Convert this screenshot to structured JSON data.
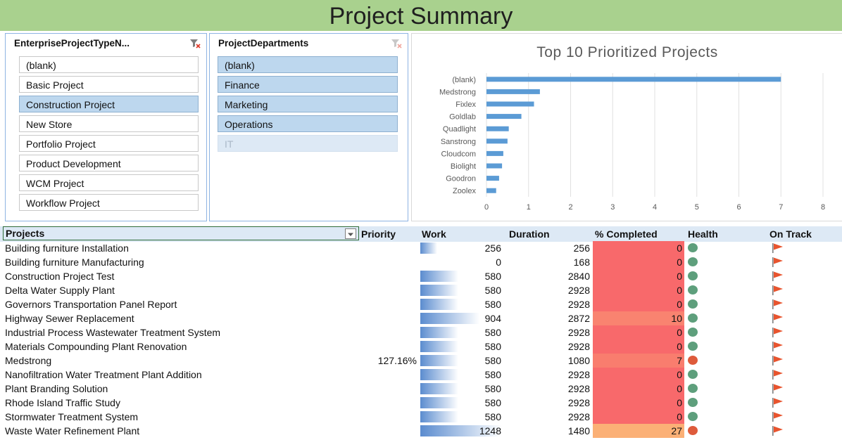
{
  "banner": {
    "title": "Project Summary",
    "color": "#a9d18e"
  },
  "slicers": [
    {
      "header": "EnterpriseProjectTypeN...",
      "icon": "clear-filter-icon",
      "items": [
        {
          "label": "(blank)",
          "state": "normal"
        },
        {
          "label": "Basic Project",
          "state": "normal"
        },
        {
          "label": "Construction Project",
          "state": "selected"
        },
        {
          "label": "New Store",
          "state": "normal"
        },
        {
          "label": "Portfolio Project",
          "state": "normal"
        },
        {
          "label": "Product Development",
          "state": "normal"
        },
        {
          "label": "WCM Project",
          "state": "normal"
        },
        {
          "label": "Workflow Project",
          "state": "normal"
        }
      ]
    },
    {
      "header": "ProjectDepartments",
      "icon": "clear-filter-icon",
      "items": [
        {
          "label": "(blank)",
          "state": "selected"
        },
        {
          "label": "Finance",
          "state": "selected"
        },
        {
          "label": "Marketing",
          "state": "selected"
        },
        {
          "label": "Operations",
          "state": "selected"
        },
        {
          "label": "IT",
          "state": "disabled"
        }
      ]
    }
  ],
  "chart_data": {
    "type": "bar",
    "orientation": "horizontal",
    "title": "Top 10 Prioritized Projects",
    "categories": [
      "(blank)",
      "Medstrong",
      "Fixlex",
      "Goldlab",
      "Quadlight",
      "Sanstrong",
      "Cloudcom",
      "Biolight",
      "Goodron",
      "Zoolex"
    ],
    "values": [
      7,
      1.27,
      1.13,
      0.83,
      0.53,
      0.5,
      0.4,
      0.37,
      0.3,
      0.23
    ],
    "xlim": [
      0,
      8
    ],
    "xticks": [
      "0",
      "1",
      "2",
      "3",
      "4",
      "5",
      "6",
      "7",
      "8"
    ],
    "grid": true,
    "bar_color": "#5b9bd5"
  },
  "table": {
    "headers": {
      "projects": "Projects",
      "priority": "Priority",
      "work": "Work",
      "duration": "Duration",
      "completed": "% Completed",
      "health": "Health",
      "on_track": "On Track"
    },
    "filter_icon": "dropdown-filter-icon",
    "status_colors": {
      "green": "#5e9f7c",
      "red": "#de5b3b",
      "flag": "#e8542e"
    },
    "rows": [
      {
        "name": "Building furniture Installation",
        "priority": "",
        "work": "256",
        "work_fraction": 0.205,
        "duration": "256",
        "completed": "0",
        "completed_color": "#f8696b",
        "health": "green"
      },
      {
        "name": "Building furniture Manufacturing",
        "priority": "",
        "work": "0",
        "work_fraction": 0,
        "duration": "168",
        "completed": "0",
        "completed_color": "#f8696b",
        "health": "green"
      },
      {
        "name": "Construction Project Test",
        "priority": "",
        "work": "580",
        "work_fraction": 0.465,
        "duration": "2840",
        "completed": "0",
        "completed_color": "#f8696b",
        "health": "green"
      },
      {
        "name": "Delta Water Supply Plant",
        "priority": "",
        "work": "580",
        "work_fraction": 0.465,
        "duration": "2928",
        "completed": "0",
        "completed_color": "#f8696b",
        "health": "green"
      },
      {
        "name": "Governors Transportation Panel Report",
        "priority": "",
        "work": "580",
        "work_fraction": 0.465,
        "duration": "2928",
        "completed": "0",
        "completed_color": "#f8696b",
        "health": "green"
      },
      {
        "name": "Highway Sewer Replacement",
        "priority": "",
        "work": "904",
        "work_fraction": 0.724,
        "duration": "2872",
        "completed": "10",
        "completed_color": "#f98370",
        "health": "green"
      },
      {
        "name": "Industrial Process Wastewater Treatment System",
        "priority": "",
        "work": "580",
        "work_fraction": 0.465,
        "duration": "2928",
        "completed": "0",
        "completed_color": "#f8696b",
        "health": "green"
      },
      {
        "name": "Materials Compounding Plant Renovation",
        "priority": "",
        "work": "580",
        "work_fraction": 0.465,
        "duration": "2928",
        "completed": "0",
        "completed_color": "#f8696b",
        "health": "green"
      },
      {
        "name": "Medstrong",
        "priority": "127.16%",
        "work": "580",
        "work_fraction": 0.465,
        "duration": "1080",
        "completed": "7",
        "completed_color": "#f97d6e",
        "health": "red"
      },
      {
        "name": "Nanofiltration Water Treatment Plant Addition",
        "priority": "",
        "work": "580",
        "work_fraction": 0.465,
        "duration": "2928",
        "completed": "0",
        "completed_color": "#f8696b",
        "health": "green"
      },
      {
        "name": "Plant Branding Solution",
        "priority": "",
        "work": "580",
        "work_fraction": 0.465,
        "duration": "2928",
        "completed": "0",
        "completed_color": "#f8696b",
        "health": "green"
      },
      {
        "name": "Rhode Island Traffic Study",
        "priority": "",
        "work": "580",
        "work_fraction": 0.465,
        "duration": "2928",
        "completed": "0",
        "completed_color": "#f8696b",
        "health": "green"
      },
      {
        "name": "Stormwater Treatment System",
        "priority": "",
        "work": "580",
        "work_fraction": 0.465,
        "duration": "2928",
        "completed": "0",
        "completed_color": "#f8696b",
        "health": "green"
      },
      {
        "name": "Waste Water Refinement Plant",
        "priority": "",
        "work": "1248",
        "work_fraction": 1.0,
        "duration": "1480",
        "completed": "27",
        "completed_color": "#fbb076",
        "health": "red"
      }
    ]
  }
}
